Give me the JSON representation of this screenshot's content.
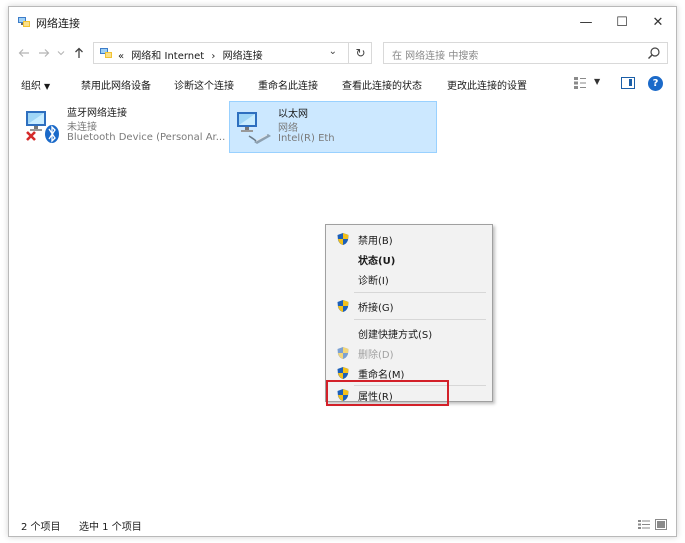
{
  "window": {
    "title": "网络连接",
    "controls": {
      "minimize": "—",
      "maximize": "☐",
      "close": "✕"
    }
  },
  "address_bar": {
    "prefix": "«",
    "crumbs": [
      "网络和 Internet",
      "网络连接"
    ],
    "separator": "›",
    "dropdown": "⌄",
    "refresh": "↻"
  },
  "search": {
    "placeholder": "在 网络连接 中搜索"
  },
  "toolbar": {
    "organize": "组织",
    "disable_device": "禁用此网络设备",
    "diagnose": "诊断这个连接",
    "rename": "重命名此连接",
    "view_status": "查看此连接的状态",
    "change_settings": "更改此连接的设置",
    "help": "?"
  },
  "connections": [
    {
      "name": "蓝牙网络连接",
      "status": "未连接",
      "device": "Bluetooth Device (Personal Ar...",
      "icon": "bluetooth-network-adapter-icon",
      "selected": false
    },
    {
      "name": "以太网",
      "status": "网络",
      "device": "Intel(R) Eth",
      "icon": "ethernet-adapter-icon",
      "selected": true
    }
  ],
  "context_menu": {
    "items": [
      {
        "label": "禁用(B)",
        "icon": "uac-shield-icon",
        "bold": false,
        "disabled": false
      },
      {
        "label": "状态(U)",
        "icon": "",
        "bold": true,
        "disabled": false
      },
      {
        "label": "诊断(I)",
        "icon": "",
        "bold": false,
        "disabled": false
      },
      {
        "label": "桥接(G)",
        "icon": "uac-shield-icon",
        "bold": false,
        "disabled": false
      },
      {
        "label": "创建快捷方式(S)",
        "icon": "",
        "bold": false,
        "disabled": false
      },
      {
        "label": "删除(D)",
        "icon": "uac-shield-icon",
        "bold": false,
        "disabled": true
      },
      {
        "label": "重命名(M)",
        "icon": "uac-shield-icon",
        "bold": false,
        "disabled": false
      },
      {
        "label": "属性(R)",
        "icon": "uac-shield-icon",
        "bold": false,
        "disabled": false,
        "highlighted": true
      }
    ]
  },
  "status_bar": {
    "item_count": "2 个项目",
    "selected_count": "选中 1 个项目"
  },
  "colors": {
    "selection_bg": "#cce8ff",
    "selection_border": "#99d1ff",
    "highlight_box": "#d32029",
    "accent": "#1b6ac9",
    "shield_blue": "#1c5fb8",
    "shield_yellow": "#f3c01a"
  }
}
